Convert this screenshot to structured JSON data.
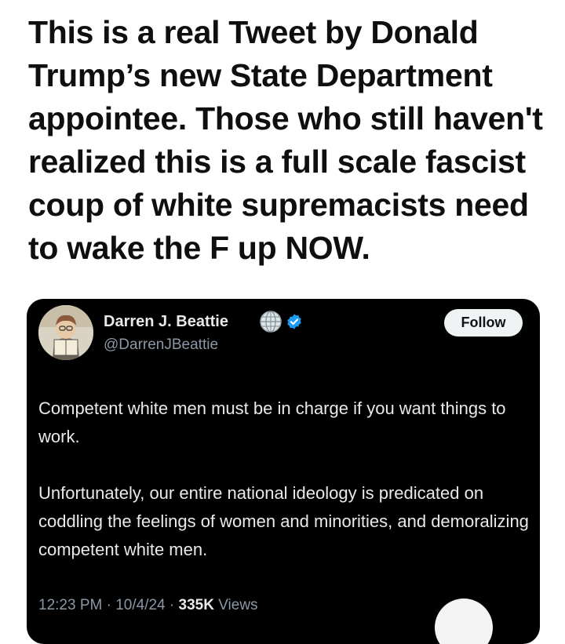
{
  "post": {
    "headline": "This is a real Tweet by Donald Trump’s new State Department appointee. Those who still haven't realized this is a full scale fascist coup of white supremacists need to wake the F up NOW."
  },
  "tweet": {
    "display_name": "Darren J. Beattie",
    "handle": "@DarrenJBeattie",
    "follow_label": "Follow",
    "paragraphs": [
      "Competent white men must be in charge if you want things to work.",
      "Unfortunately, our entire national ideology is predicated on coddling the feelings of women and minorities, and demoralizing competent white men."
    ],
    "time": "12:23 PM",
    "date": "10/4/24",
    "separator": " · ",
    "views_count": "335K",
    "views_label": "Views"
  },
  "colors": {
    "card_background": "#000000",
    "verified_blue": "#1d9bf0",
    "secondary_text": "#8b98a5"
  },
  "icons": {
    "globe_badge": "globe-icon",
    "verified_badge": "verified-check-icon"
  }
}
